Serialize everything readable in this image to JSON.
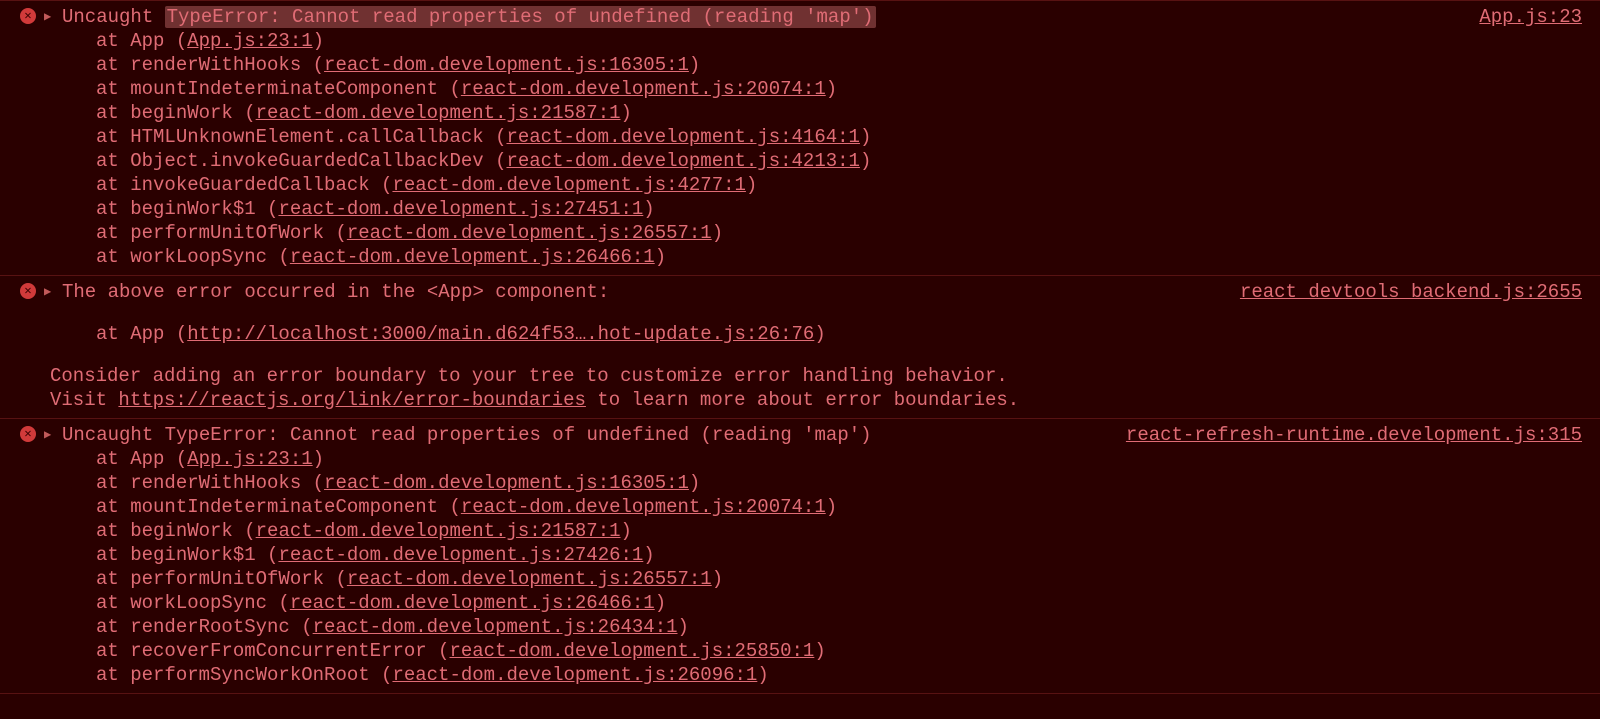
{
  "entries": [
    {
      "prefix": "Uncaught ",
      "message_hl": "TypeError: Cannot read properties of undefined (reading 'map')",
      "source_link": "App.js:23",
      "stack": [
        {
          "fn": "App",
          "loc": "App.js:23:1"
        },
        {
          "fn": "renderWithHooks",
          "loc": "react-dom.development.js:16305:1"
        },
        {
          "fn": "mountIndeterminateComponent",
          "loc": "react-dom.development.js:20074:1"
        },
        {
          "fn": "beginWork",
          "loc": "react-dom.development.js:21587:1"
        },
        {
          "fn": "HTMLUnknownElement.callCallback",
          "loc": "react-dom.development.js:4164:1"
        },
        {
          "fn": "Object.invokeGuardedCallbackDev",
          "loc": "react-dom.development.js:4213:1"
        },
        {
          "fn": "invokeGuardedCallback",
          "loc": "react-dom.development.js:4277:1"
        },
        {
          "fn": "beginWork$1",
          "loc": "react-dom.development.js:27451:1"
        },
        {
          "fn": "performUnitOfWork",
          "loc": "react-dom.development.js:26557:1"
        },
        {
          "fn": "workLoopSync",
          "loc": "react-dom.development.js:26466:1"
        }
      ]
    },
    {
      "message_plain": "The above error occurred in the <App> component:",
      "source_link": "react_devtools_backend.js:2655",
      "stack2": [
        {
          "fn": "App",
          "loc": "http://localhost:3000/main.d624f53….hot-update.js:26:76"
        }
      ],
      "tail_line1": "Consider adding an error boundary to your tree to customize error handling behavior.",
      "tail_line2a": "Visit ",
      "tail_link": "https://reactjs.org/link/error-boundaries",
      "tail_line2b": " to learn more about error boundaries."
    },
    {
      "prefix": "Uncaught ",
      "message_plain2": "TypeError: Cannot read properties of undefined (reading 'map')",
      "source_link": "react-refresh-runtime.development.js:315",
      "stack": [
        {
          "fn": "App",
          "loc": "App.js:23:1"
        },
        {
          "fn": "renderWithHooks",
          "loc": "react-dom.development.js:16305:1"
        },
        {
          "fn": "mountIndeterminateComponent",
          "loc": "react-dom.development.js:20074:1"
        },
        {
          "fn": "beginWork",
          "loc": "react-dom.development.js:21587:1"
        },
        {
          "fn": "beginWork$1",
          "loc": "react-dom.development.js:27426:1"
        },
        {
          "fn": "performUnitOfWork",
          "loc": "react-dom.development.js:26557:1"
        },
        {
          "fn": "workLoopSync",
          "loc": "react-dom.development.js:26466:1"
        },
        {
          "fn": "renderRootSync",
          "loc": "react-dom.development.js:26434:1"
        },
        {
          "fn": "recoverFromConcurrentError",
          "loc": "react-dom.development.js:25850:1"
        },
        {
          "fn": "performSyncWorkOnRoot",
          "loc": "react-dom.development.js:26096:1"
        }
      ]
    }
  ]
}
